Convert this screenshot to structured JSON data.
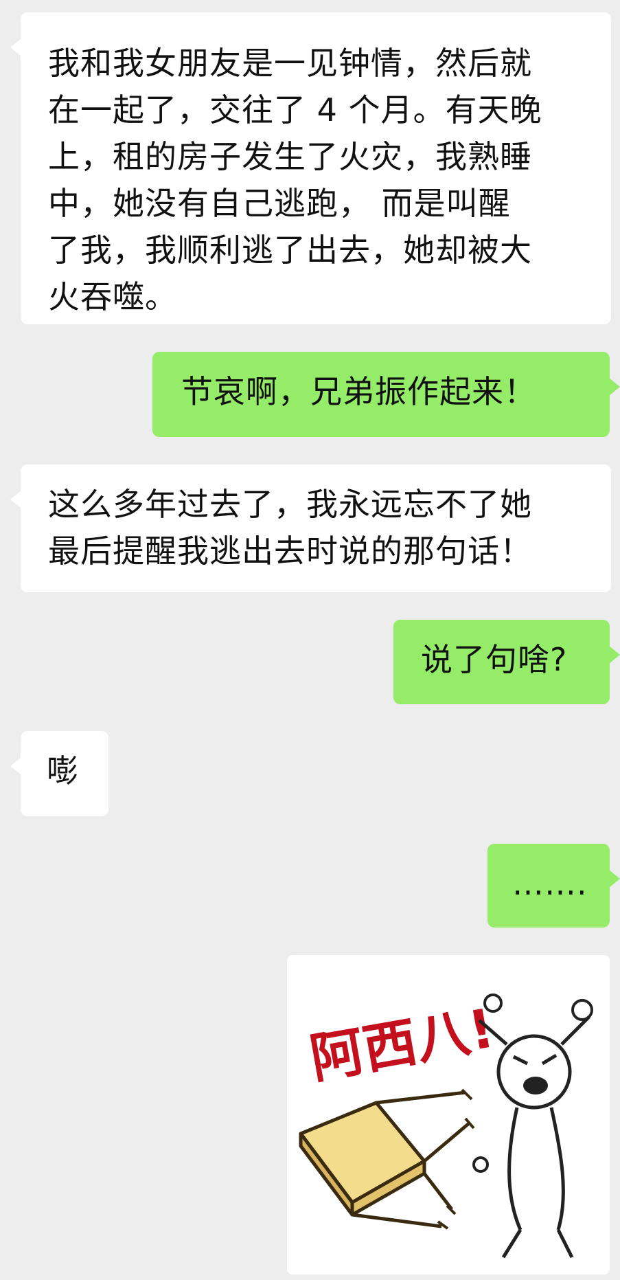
{
  "messages": [
    {
      "side": "incoming",
      "lines": [
        "我和我女朋友是一见钟情，然后就",
        "在一起了，交往了 4 个月。有天晚",
        "上，租的房子发生了火灾，我熟睡",
        "中，她没有自己逃跑， 而是叫醒",
        "了我，我顺利逃了出去，她却被大",
        "火吞噬。"
      ]
    },
    {
      "side": "outgoing",
      "lines": [
        "节哀啊，兄弟振作起来！"
      ]
    },
    {
      "side": "incoming",
      "lines": [
        "这么多年过去了，我永远忘不了她",
        "最后提醒我逃出去时说的那句话！"
      ]
    },
    {
      "side": "outgoing",
      "lines": [
        "说了句啥?"
      ]
    },
    {
      "side": "incoming",
      "lines": [
        "嘭"
      ]
    },
    {
      "side": "outgoing",
      "lines": [
        "……."
      ]
    }
  ],
  "sticker": {
    "text": "阿西八!",
    "description_icon": "flip-table-sticker"
  },
  "colors": {
    "background": "#ededed",
    "incoming_bubble": "#ffffff",
    "outgoing_bubble": "#95ec69",
    "sticker_text": "#c4101d"
  }
}
